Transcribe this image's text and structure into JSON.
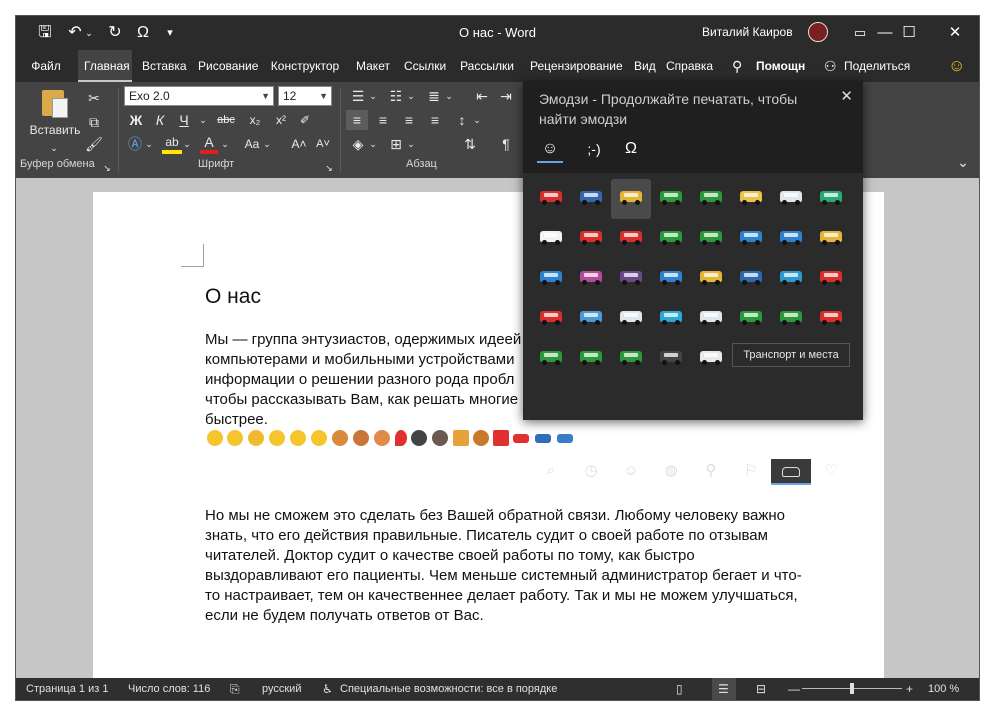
{
  "window": {
    "title": "О нас  -  Word",
    "user": "Виталий Каиров",
    "controls": {
      "minimize": "—",
      "maximize": "☐",
      "close": "✕"
    },
    "qat": {
      "save": "🖫",
      "undo": "↶",
      "redo": "↻",
      "symbol": "Ω",
      "more": "▾"
    }
  },
  "tabs": [
    {
      "label": "Файл"
    },
    {
      "label": "Главная"
    },
    {
      "label": "Вставка"
    },
    {
      "label": "Рисование"
    },
    {
      "label": "Конструктор"
    },
    {
      "label": "Макет"
    },
    {
      "label": "Ссылки"
    },
    {
      "label": "Рассылки"
    },
    {
      "label": "Рецензирование"
    },
    {
      "label": "Вид"
    },
    {
      "label": "Справка"
    }
  ],
  "tell_me": "Помощн",
  "share": "Поделиться",
  "ribbon": {
    "paste": "Вставить",
    "clipboard_label": "Буфер обмена",
    "font_label": "Шрифт",
    "paragraph_label": "Абзац",
    "font_name": "Exo 2.0",
    "font_size": "12",
    "bold": "Ж",
    "italic": "К",
    "underline": "Ч",
    "strike": "abc",
    "sub": "x₂",
    "sup": "x²",
    "grow": "A˄",
    "shrink": "A˅",
    "case": "Aa",
    "pilcrow": "¶"
  },
  "emoji_panel": {
    "title": "Эмодзи - Продолжайте печатать, чтобы найти эмодзи",
    "close": "✕",
    "tabs": [
      "☺",
      ";-)",
      "Ω"
    ],
    "tooltip": "Транспорт и места",
    "categories": [
      "⌕",
      "◷",
      "☺",
      "◍",
      "⚲",
      "⚐",
      "🚗",
      "♡"
    ]
  },
  "document": {
    "heading": "О нас",
    "para1": [
      "Мы — группа энтузиастов, одержимых идеей",
      "компьютерами и мобильными устройствами",
      "информации о решении разного рода пробл",
      "чтобы рассказывать Вам, как решать многие",
      "быстрее."
    ],
    "para2": [
      "Но мы не сможем это сделать без Вашей обратной связи. Любому человеку важно",
      "знать, что его действия правильные. Писатель судит о своей работе по отзывам",
      "читателей. Доктор судит о качестве своей работы по тому, как быстро",
      "выздоравливают его пациенты. Чем меньше системный администратор бегает и что-",
      "то настраивает, тем он качественнее делает работу. Так и мы не можем улучшаться,",
      "если не будем получать ответов от Вас."
    ]
  },
  "statusbar": {
    "page": "Страница 1 из 1",
    "words": "Число слов: 116",
    "language": "русский",
    "accessibility": "Специальные возможности: все в порядке",
    "zoom": "100 %",
    "zoom_level": 1.0
  },
  "colors": {
    "accent": "#6aa4e6",
    "titlebar": "#2b2b2b",
    "ribbon": "#444444"
  }
}
